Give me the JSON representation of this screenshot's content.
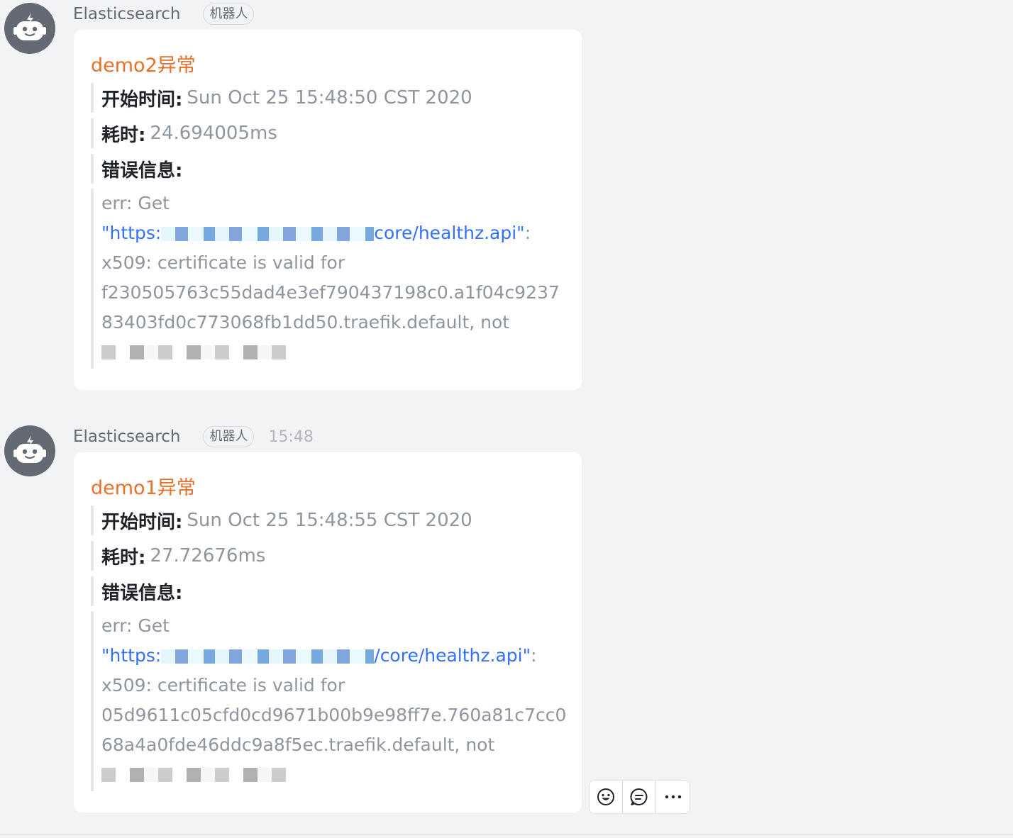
{
  "messages": [
    {
      "sender": "Elasticsearch",
      "bot_tag": "机器人",
      "time": "",
      "avatar_icon": "robot-icon",
      "card": {
        "title": "demo2异常",
        "start_label": "开始时间:",
        "start_value": "Sun Oct 25 15:48:50 CST 2020",
        "duration_label": "耗时:",
        "duration_value": "24.694005ms",
        "error_label": "错误信息:",
        "error_lines": [
          "err: Get",
          "x509: certificate is valid for",
          "f230505763c55dad4e3ef790437198c0.a1f04c9237",
          "83403fd0c773068fb1dd50.traefik.default, not"
        ],
        "url_prefix": "\"https:",
        "url_suffix": "core/healthz.api\"",
        "url_colon": ":"
      }
    },
    {
      "sender": "Elasticsearch",
      "bot_tag": "机器人",
      "time": "15:48",
      "avatar_icon": "robot-icon",
      "card": {
        "title": "demo1异常",
        "start_label": "开始时间:",
        "start_value": "Sun Oct 25 15:48:55 CST 2020",
        "duration_label": "耗时:",
        "duration_value": "27.72676ms",
        "error_label": "错误信息:",
        "error_lines": [
          "err: Get",
          "x509: certificate is valid for",
          "05d9611c05cfd0cd9671b00b9e98ff7e.760a81c7cc0",
          "68a4a0fde46ddc9a8f5ec.traefik.default, not"
        ],
        "url_prefix": "\"https:",
        "url_suffix": "/core/healthz.api\"",
        "url_colon": ":"
      }
    }
  ],
  "actions": [
    {
      "icon": "emoji-icon"
    },
    {
      "icon": "reply-icon"
    },
    {
      "icon": "more-icon"
    }
  ],
  "colors": {
    "background": "#f2f3f5",
    "title": "#e8702a",
    "link": "#3370ff",
    "muted": "#8f959e",
    "avatar": "#646a73"
  }
}
